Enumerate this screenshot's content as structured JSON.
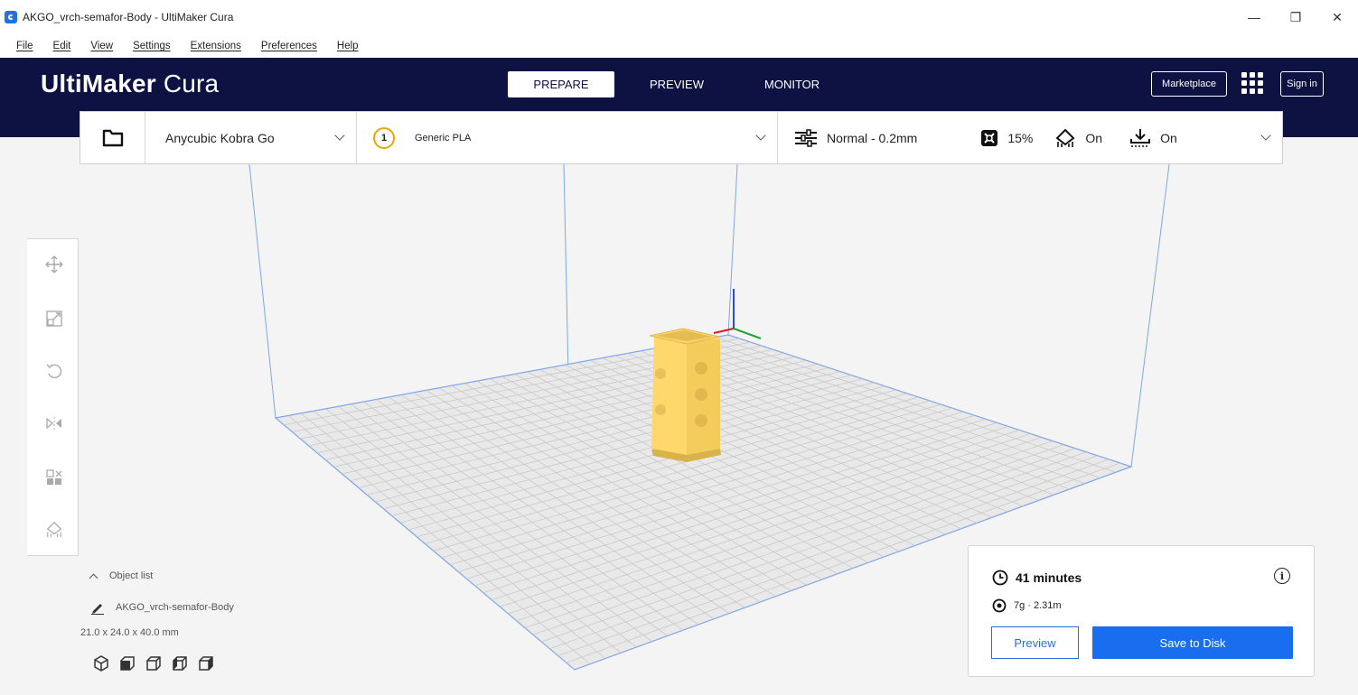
{
  "window": {
    "title": "AKGO_vrch-semafor-Body - UltiMaker Cura",
    "minimize_glyph": "—",
    "maximize_glyph": "❐",
    "close_glyph": "✕"
  },
  "menu": [
    "File",
    "Edit",
    "View",
    "Settings",
    "Extensions",
    "Preferences",
    "Help"
  ],
  "header": {
    "logo_bold": "UltiMaker",
    "logo_light": "Cura",
    "tabs": [
      "PREPARE",
      "PREVIEW",
      "MONITOR"
    ],
    "active_tab": "PREPARE",
    "marketplace_label": "Marketplace",
    "signin_label": "Sign in"
  },
  "toolbar": {
    "printer": "Anycubic Kobra Go",
    "extruder_number": "1",
    "material": "Generic PLA",
    "profile": "Normal - 0.2mm",
    "infill": "15%",
    "support": "On",
    "adhesion": "On"
  },
  "object_list": {
    "label": "Object list",
    "object_name": "AKGO_vrch-semafor-Body",
    "dimensions": "21.0 x 24.0 x 40.0 mm"
  },
  "print_info": {
    "time": "41 minutes",
    "material": "7g · 2.31m",
    "preview_label": "Preview",
    "save_label": "Save to Disk"
  },
  "colors": {
    "header_bg": "#0e1243",
    "accent_blue": "#196ef0",
    "model_yellow": "#fed86b",
    "extruder_ring": "#e6a800"
  },
  "icons": {
    "open": "folder-icon",
    "profile": "sliders-icon",
    "infill": "infill-icon",
    "support": "support-icon",
    "adhesion": "adhesion-icon",
    "time": "clock-icon",
    "material": "spool-icon",
    "info": "info-icon"
  }
}
